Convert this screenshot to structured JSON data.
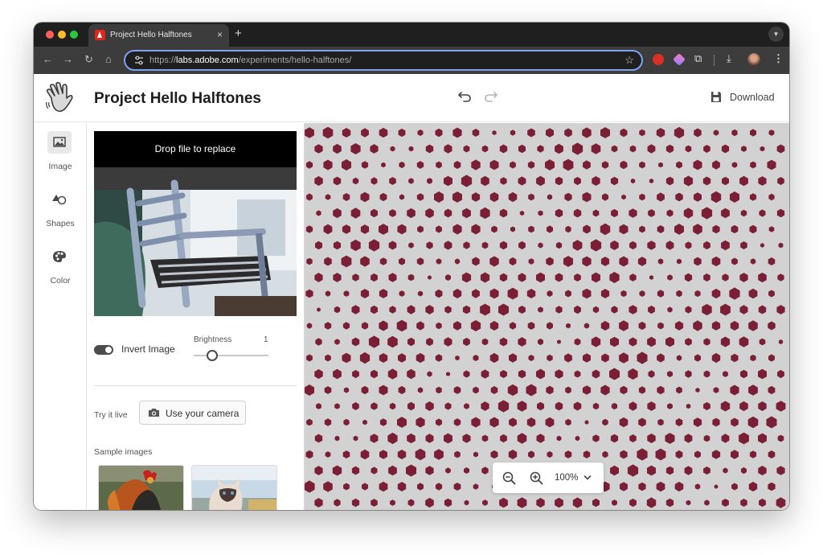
{
  "browser": {
    "tab_title": "Project Hello Halftones",
    "tab_close": "×",
    "new_tab": "+",
    "url_scheme": "https://",
    "url_host": "labs.adobe.com",
    "url_path": "/experiments/hello-halftones/",
    "accent_color": "#7ca4f0"
  },
  "header": {
    "title": "Project Hello Halftones",
    "download_label": "Download"
  },
  "rail": {
    "items": [
      {
        "label": "Image",
        "icon": "image-icon",
        "active": true
      },
      {
        "label": "Shapes",
        "icon": "shapes-icon",
        "active": false
      },
      {
        "label": "Color",
        "icon": "palette-icon",
        "active": false
      }
    ]
  },
  "panel": {
    "drop_label": "Drop file to replace",
    "invert_label": "Invert Image",
    "invert_on": true,
    "brightness_label": "Brightness",
    "brightness_value": "1",
    "brightness_level": 0.25,
    "try_live_label": "Try it live",
    "camera_button_label": "Use your camera",
    "samples_label": "Sample images"
  },
  "canvas": {
    "background_color": "#d2d2d2",
    "dot_color": "#7a1f35",
    "shape": "hexagon",
    "zoom_value": "100%"
  }
}
